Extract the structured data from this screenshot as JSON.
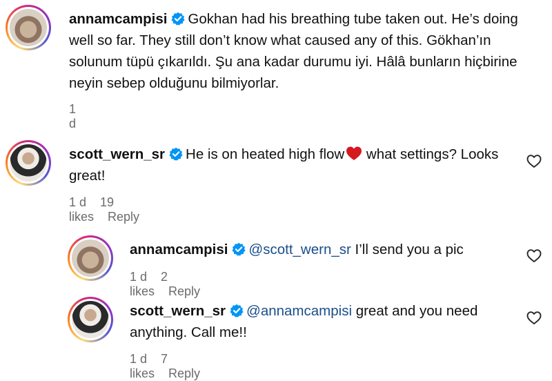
{
  "comments": [
    {
      "username": "annamcampisi",
      "text": "Gokhan had his breathing tube taken out. He’s doing well so far. They still don’t know what caused any of this. Gökhan’ın solunum tüpü çıkarıldı. Şu ana kadar durumu iyi. Hâlâ bunların hiçbirine neyin sebep olduğunu bilmiyorlar.",
      "time": "1 d"
    },
    {
      "username": "scott_wern_sr",
      "text_before": "He is on heated high flow",
      "text_after": " what settings? Looks great!",
      "time": "1 d",
      "likes": "19 likes",
      "reply": "Reply"
    },
    {
      "username": "annamcampisi",
      "mention": "@scott_wern_sr",
      "text": " I’ll send you a pic",
      "time": "1 d",
      "likes": "2 likes",
      "reply": "Reply"
    },
    {
      "username": "scott_wern_sr",
      "mention": "@annamcampisi",
      "text": " great and you need anything. Call me!!",
      "time": "1 d",
      "likes": "7 likes",
      "reply": "Reply"
    }
  ],
  "colors": {
    "verified": "#0095f6",
    "mention": "#1a4e8a",
    "meta": "#6b6b6b"
  }
}
